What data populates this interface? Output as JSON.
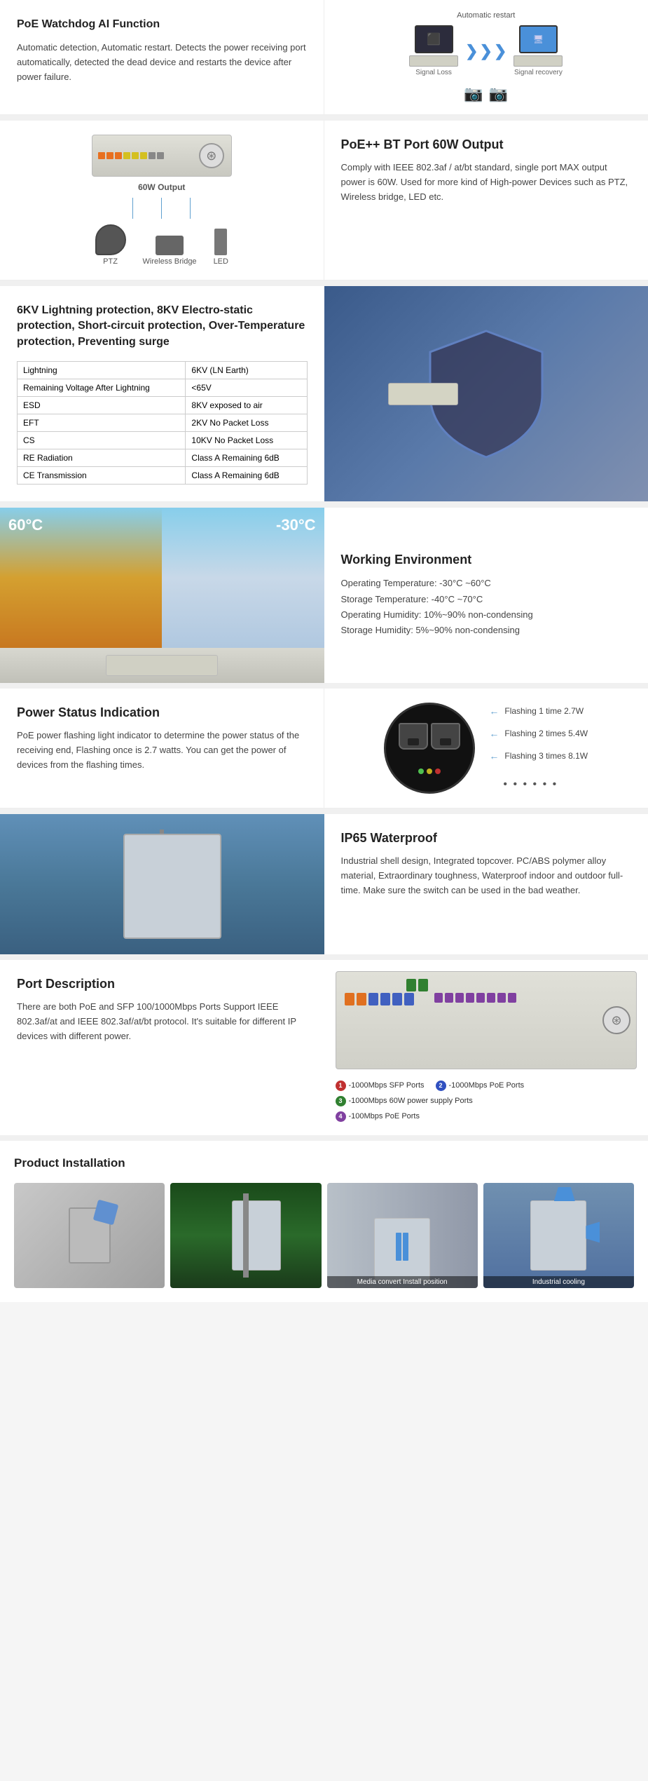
{
  "section1": {
    "title": "PoE Watchdog AI Function",
    "description": "Automatic detection, Automatic restart. Detects the power receiving port automatically, detected the dead device and restarts the device after power failure.",
    "diagram": {
      "auto_restart": "Automatic restart",
      "signal_loss": "Signal Loss",
      "signal_recovery": "Signal recovery"
    }
  },
  "section2": {
    "title": "PoE++ BT Port 60W Output",
    "description": "Comply with IEEE 802.3af / at/bt standard, single port MAX output power is 60W. Used for more kind of High-power Devices such as PTZ, Wireless bridge, LED etc.",
    "output_label": "60W Output",
    "devices": [
      "PTZ",
      "Wireless Bridge",
      "LED"
    ]
  },
  "section3": {
    "title": "6KV Lightning protection, 8KV Electro-static protection, Short-circuit protection, Over-Temperature protection, Preventing surge",
    "table": {
      "headers": [
        "",
        ""
      ],
      "rows": [
        [
          "Lightning",
          "6KV (LN Earth)"
        ],
        [
          "Remaining Voltage After Lightning",
          "<65V"
        ],
        [
          "ESD",
          "8KV exposed to air"
        ],
        [
          "EFT",
          "2KV No Packet Loss"
        ],
        [
          "CS",
          "10KV No Packet Loss"
        ],
        [
          "RE Radiation",
          "Class A Remaining 6dB"
        ],
        [
          "CE Transmission",
          "Class A Remaining 6dB"
        ]
      ]
    }
  },
  "section4": {
    "temp_hot": "60°C",
    "temp_cold": "-30°C",
    "title": "Working Environment",
    "details": [
      "Operating Temperature: -30°C ~60°C",
      "Storage Temperature: -40°C ~70°C",
      "Operating Humidity: 10%~90% non-condensing",
      "Storage Humidity: 5%~90% non-condensing"
    ]
  },
  "section5": {
    "title": "Power Status Indication",
    "description": "PoE power flashing light indicator to determine the power status of the receiving end, Flashing once is 2.7 watts. You can get the power of devices from the flashing times.",
    "flash_labels": [
      "Flashing 1 time 2.7W",
      "Flashing 2 times 5.4W",
      "Flashing 3 times 8.1W"
    ]
  },
  "section6": {
    "title": "IP65 Waterproof",
    "description": "Industrial shell design, Integrated topcover. PC/ABS polymer alloy material, Extraordinary toughness, Waterproof indoor and outdoor full-time. Make sure the switch can be used in the bad weather."
  },
  "section7": {
    "title": "Port Description",
    "description": "There are both PoE and SFP 100/1000Mbps Ports Support IEEE 802.3af/at and IEEE 802.3af/at/bt protocol. It's suitable for different IP devices with different power.",
    "legend": [
      {
        "color": "red",
        "num": "1",
        "label": "-1000Mbps SFP Ports"
      },
      {
        "color": "blue",
        "num": "2",
        "label": "-1000Mbps PoE Ports"
      },
      {
        "color": "green",
        "num": "3",
        "label": "-1000Mbps 60W power supply Ports"
      },
      {
        "color": "purple",
        "num": "4",
        "label": "-100Mbps PoE Ports"
      }
    ]
  },
  "section8": {
    "title": "Product Installation",
    "images": [
      {
        "label": "",
        "bg": "bracket"
      },
      {
        "label": "",
        "bg": "pole"
      },
      {
        "label": "Media convert Install position",
        "bg": "wall"
      },
      {
        "label": "Industrial cooling",
        "bg": "cooling"
      }
    ]
  }
}
